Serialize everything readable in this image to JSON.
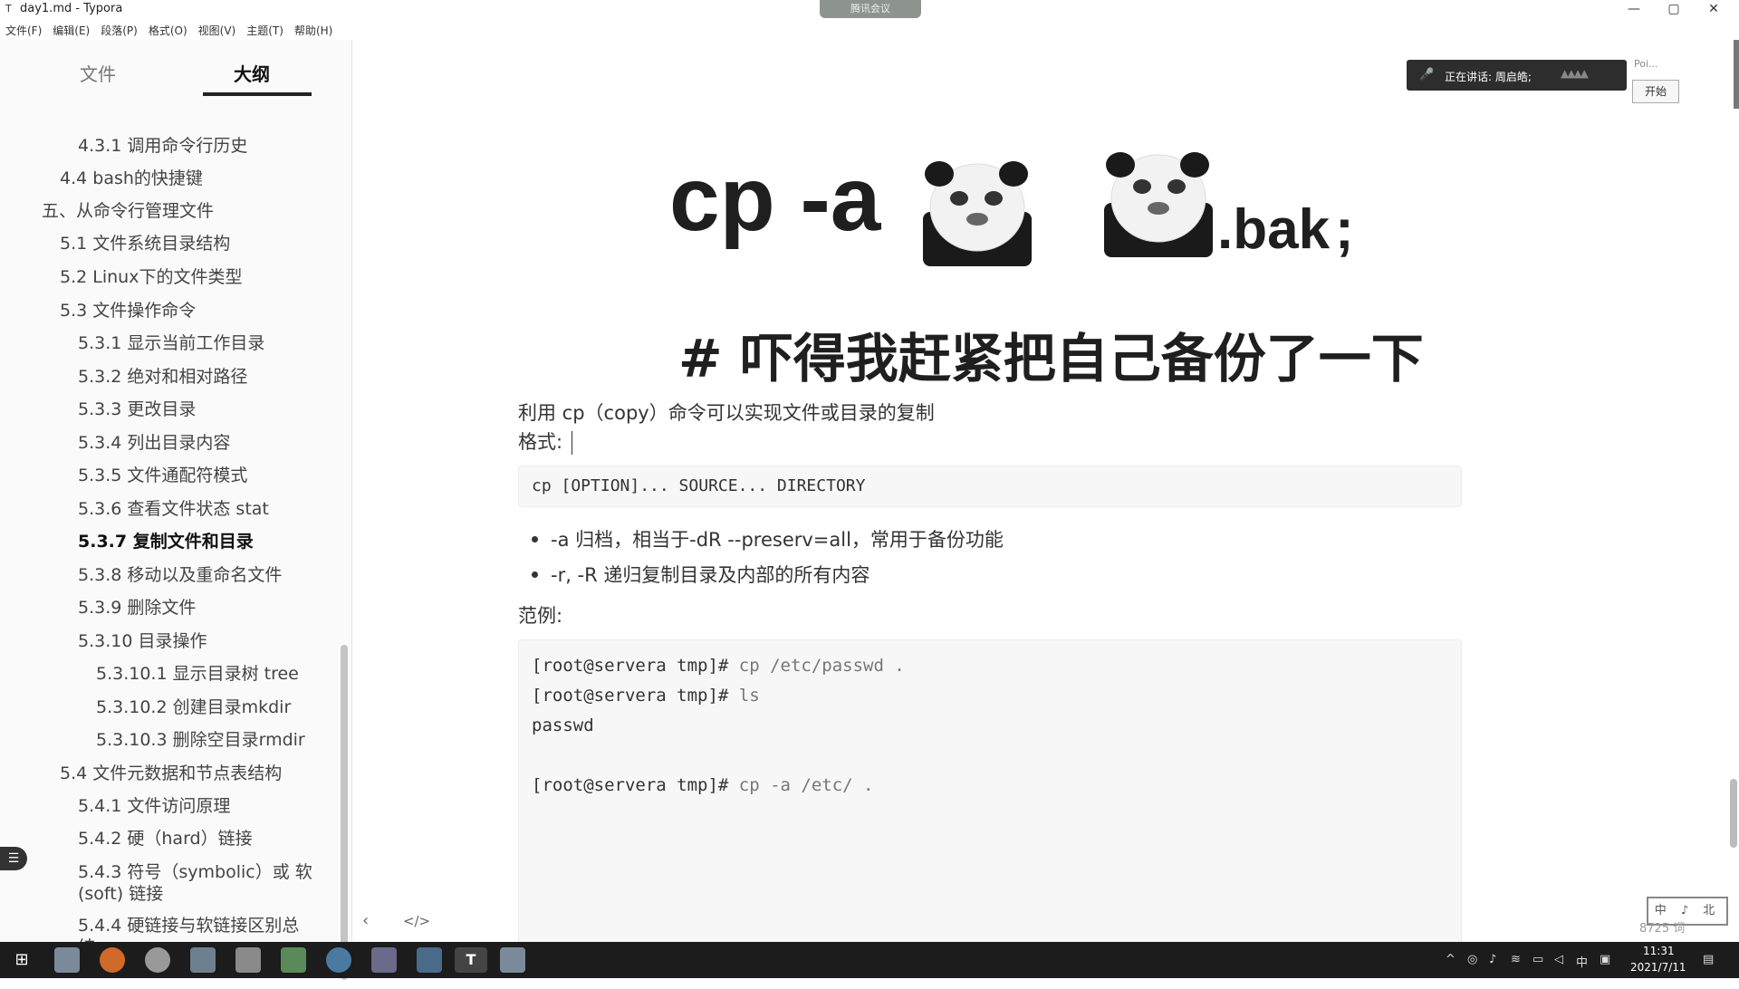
{
  "window": {
    "title": "day1.md - Typora",
    "meeting_label": "腾讯会议",
    "controls": [
      "—",
      "▢",
      "✕"
    ]
  },
  "menu": [
    "文件(F)",
    "编辑(E)",
    "段落(P)",
    "格式(O)",
    "视图(V)",
    "主题(T)",
    "帮助(H)"
  ],
  "sidebar": {
    "tabs": [
      "文件",
      "大纲"
    ],
    "active_tab": "大纲",
    "outline": [
      {
        "label": "4.3.1 调用命令行历史",
        "level": 3
      },
      {
        "label": "4.4 bash的快捷键",
        "level": 2
      },
      {
        "label": "五、从命令行管理文件",
        "level": 1
      },
      {
        "label": "5.1 文件系统目录结构",
        "level": 2
      },
      {
        "label": "5.2 Linux下的文件类型",
        "level": 2
      },
      {
        "label": "5.3 文件操作命令",
        "level": 2
      },
      {
        "label": "5.3.1 显示当前工作目录",
        "level": 3
      },
      {
        "label": "5.3.2 绝对和相对路径",
        "level": 3
      },
      {
        "label": "5.3.3 更改目录",
        "level": 3
      },
      {
        "label": "5.3.4 列出目录内容",
        "level": 3
      },
      {
        "label": "5.3.5 文件通配符模式",
        "level": 3
      },
      {
        "label": "5.3.6 查看文件状态 stat",
        "level": 3
      },
      {
        "label": "5.3.7 复制文件和目录",
        "level": 3,
        "active": true
      },
      {
        "label": "5.3.8 移动以及重命名文件",
        "level": 3
      },
      {
        "label": "5.3.9 删除文件",
        "level": 3
      },
      {
        "label": "5.3.10 目录操作",
        "level": 3
      },
      {
        "label": "5.3.10.1 显示目录树 tree",
        "level": 4
      },
      {
        "label": "5.3.10.2 创建目录mkdir",
        "level": 4
      },
      {
        "label": "5.3.10.3 删除空目录rmdir",
        "level": 4
      },
      {
        "label": "5.4 文件元数据和节点表结构",
        "level": 2
      },
      {
        "label": "5.4.1 文件访问原理",
        "level": 3
      },
      {
        "label": "5.4.2 硬（hard）链接",
        "level": 3
      },
      {
        "label": "5.4.3 符号（symbolic）或 软",
        "level": 3
      },
      {
        "label": "(soft) 链接",
        "level": 3,
        "continuation": true
      },
      {
        "label": "5.4.4 硬链接与软链接区别总",
        "level": 3
      },
      {
        "label": "结",
        "level": 3,
        "continuation": true
      }
    ],
    "bottom_icons": [
      "chevron-left-icon",
      "source-code-icon"
    ]
  },
  "meme": {
    "text_cp": "cp -a",
    "text_bak": ".bak",
    "text_semicolon": ";",
    "caption": "# 吓得我赶紧把自己备份了一下"
  },
  "content": {
    "intro": "利用 cp（copy）命令可以实现文件或目录的复制",
    "format_label": "格式:",
    "syntax": "cp [OPTION]... SOURCE... DIRECTORY",
    "bullets": [
      "-a 归档，相当于-dR --preserv=all，常用于备份功能",
      "-r, -R 递归复制目录及内部的所有内容"
    ],
    "example_label": "范例:",
    "example_lines": [
      {
        "prompt": "[root@servera tmp]#",
        "cmd": " cp /etc/passwd ."
      },
      {
        "prompt": "[root@servera tmp]#",
        "cmd": " ls"
      },
      {
        "prompt": "passwd",
        "cmd": ""
      },
      {
        "prompt": "",
        "cmd": ""
      },
      {
        "prompt": "[root@servera tmp]#",
        "cmd": " cp -a /etc/ ."
      }
    ]
  },
  "overlay": {
    "speaking_label": "正在讲话: 周启皓;",
    "poi_label": "Poi...",
    "start_button": "开始",
    "ime": "中 ♪ 北",
    "word_count": "8725 词"
  },
  "taskbar": {
    "time": "11:31",
    "date": "2021/7/11",
    "ime_lang": "中"
  }
}
